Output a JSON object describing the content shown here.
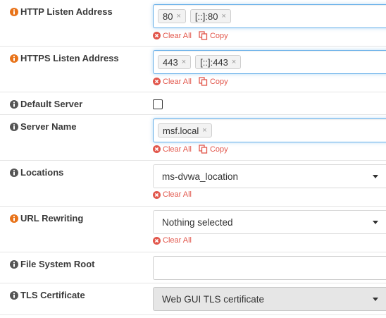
{
  "colors": {
    "label_icon_orange": "#e8731a",
    "label_icon_gray": "#555555",
    "action_red": "#e2574c",
    "focus_blue": "#66afe9"
  },
  "actions": {
    "clear_all": "Clear All",
    "copy": "Copy"
  },
  "fields": {
    "http_listen": {
      "label": "HTTP Listen Address",
      "info_icon": "info-circle",
      "tokens": [
        "80",
        "[::]:80"
      ]
    },
    "https_listen": {
      "label": "HTTPS Listen Address",
      "info_icon": "info-circle",
      "tokens": [
        "443",
        "[::]:443"
      ]
    },
    "default_server": {
      "label": "Default Server",
      "info_icon": "info-circle",
      "checked": false
    },
    "server_name": {
      "label": "Server Name",
      "info_icon": "info-circle",
      "tokens": [
        "msf.local"
      ]
    },
    "locations": {
      "label": "Locations",
      "info_icon": "info-circle",
      "value": "ms-dvwa_location"
    },
    "url_rewriting": {
      "label": "URL Rewriting",
      "info_icon": "info-circle",
      "value": "Nothing selected"
    },
    "file_system_root": {
      "label": "File System Root",
      "info_icon": "info-circle",
      "value": ""
    },
    "tls_certificate": {
      "label": "TLS Certificate",
      "info_icon": "info-circle",
      "value": "Web GUI TLS certificate"
    }
  }
}
